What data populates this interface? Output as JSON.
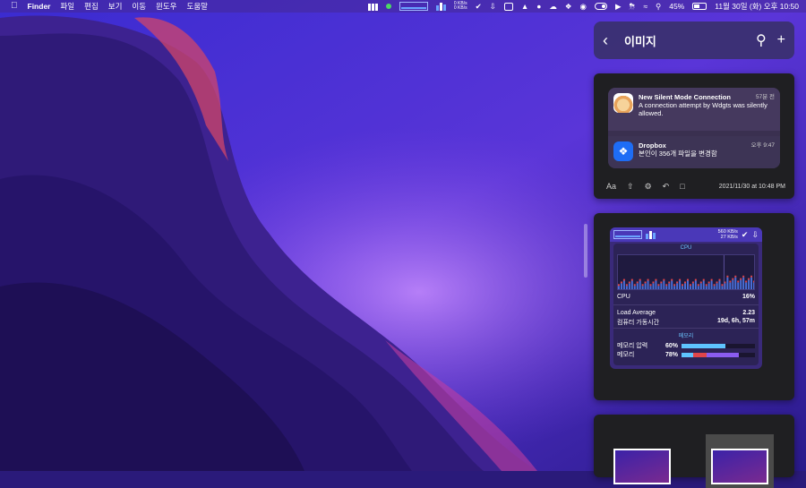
{
  "menubar": {
    "app_name": "Finder",
    "menus": [
      "파일",
      "편집",
      "보기",
      "이동",
      "윈도우",
      "도움말"
    ],
    "net_up": "0 KB/s",
    "net_down": "0 KB/s",
    "battery": "45%",
    "datetime": "11월 30일 (화) 오후 10:50"
  },
  "panel": {
    "title": "이미지"
  },
  "card1": {
    "notifications": [
      {
        "title": "New Silent Mode Connection",
        "body": "A connection attempt by Wdgts was silently allowed.",
        "time": "57분 전"
      },
      {
        "title": "Dropbox",
        "body": "본인이 356개 파일을 변경함",
        "time": "오후 9:47"
      }
    ],
    "timestamp": "2021/11/30 at 10:48 PM"
  },
  "card2": {
    "net_up": "560 KB/s",
    "net_down": "27 KB/s",
    "cpu_section": "CPU",
    "cpu_label": "CPU",
    "cpu_value": "16%",
    "load_label": "Load Average",
    "load_value": "2.23",
    "uptime_label": "컴퓨터 가동시간",
    "uptime_value": "19d, 6h, 57m",
    "mem_section": "메모리",
    "mem_pressure_label": "메모리 압력",
    "mem_pressure_value": "60%",
    "mem_pressure_fraction": 0.6,
    "mem_label": "메모리",
    "mem_value": "78%",
    "mem_fraction": 0.78
  },
  "colors": {
    "accent_blue": "#5ec4ff",
    "cpu_red": "#e0454a",
    "mem_purple": "#8a5cf0"
  }
}
